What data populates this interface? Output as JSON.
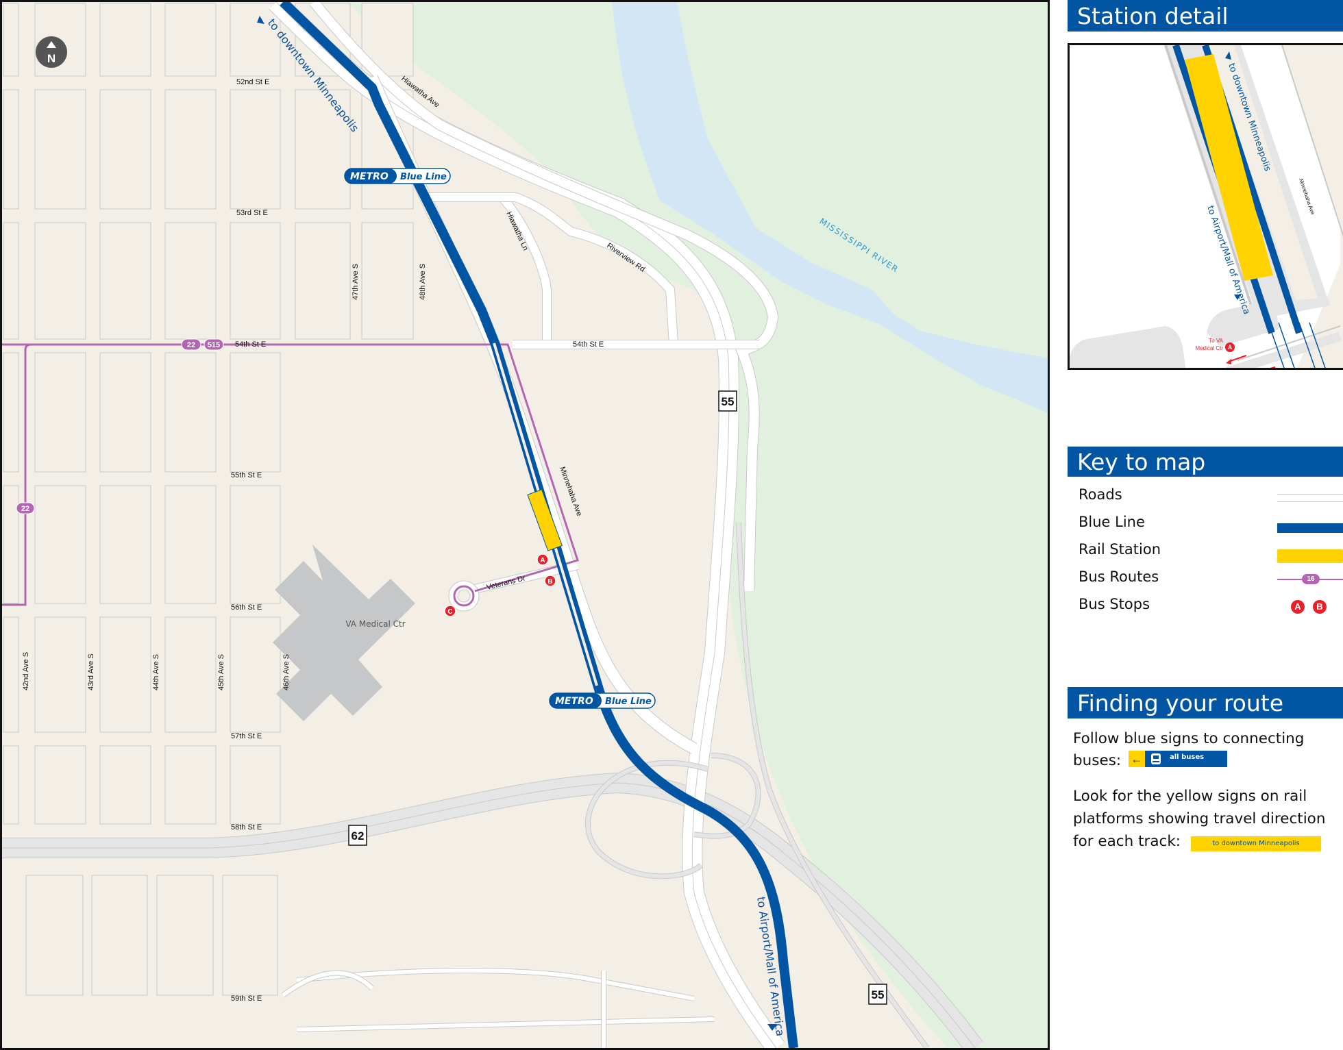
{
  "map": {
    "north_label": "N",
    "streets_ew": [
      "52nd St E",
      "53rd St E",
      "54th St E",
      "54th St E",
      "55th St E",
      "56th St E",
      "57th St E",
      "58th St E",
      "59th St E"
    ],
    "streets_ns": [
      "42nd Ave S",
      "43rd Ave S",
      "44th Ave S",
      "45th Ave S",
      "46th Ave S",
      "47th Ave S",
      "48th Ave S"
    ],
    "other_roads": {
      "hiawatha_ave": "Hiawatha Ave",
      "hiawatha_ln": "Hiawatha Ln",
      "riverview_rd": "Riverview Rd",
      "minnehaha_ave": "Minnehaha Ave",
      "veterans_dr": "Veterans Dr"
    },
    "river_label": "MISSISSIPPI RIVER",
    "landmark": "VA Medical Ctr",
    "direction_north": "to downtown Minneapolis",
    "direction_south": "to Airport/Mall of America",
    "metro_badge": {
      "brand": "METRO",
      "line": "Blue Line"
    },
    "highways": [
      "55",
      "62",
      "55"
    ],
    "bus_routes": [
      "22",
      "515",
      "22"
    ],
    "bus_stops": [
      "A",
      "B",
      "C"
    ]
  },
  "station_detail": {
    "title": "Station detail",
    "direction_north": "to downtown Minneapolis",
    "direction_south": "to Airport/Mall of America",
    "street": "Minnehaha Ave",
    "bus_stop_note_line1": "To VA",
    "bus_stop_note_line2": "Medical Ctr",
    "bus_stop": "A"
  },
  "key": {
    "title": "Key to map",
    "items": [
      {
        "label": "Roads",
        "symbol": "road"
      },
      {
        "label": "Blue Line",
        "symbol": "blue-line",
        "color": "#0155a2"
      },
      {
        "label": "Rail Station",
        "symbol": "rail-station",
        "color": "#ffd200"
      },
      {
        "label": "Bus Routes",
        "symbol": "bus-route",
        "color": "#b266b2",
        "sample_route": "16"
      },
      {
        "label": "Bus Stops",
        "symbol": "bus-stop",
        "color": "#e8202a",
        "stops": [
          "A",
          "B"
        ]
      }
    ]
  },
  "finding_route": {
    "title": "Finding your route",
    "para1_line1": "Follow blue signs to connecting",
    "para1_line2": "buses:",
    "blue_sign_text": "all buses",
    "para2_line1": "Look for the yellow signs on rail",
    "para2_line2": "platforms showing travel direction",
    "para2_line3": "for each track:",
    "yellow_sign_text": "to downtown Minneapolis"
  },
  "colors": {
    "brand_blue": "#0155a2",
    "station_yellow": "#ffd200",
    "bus_purple": "#b266b2",
    "stop_red": "#e8202a",
    "land": "#f3efe7",
    "park": "#e2f0df",
    "water": "#d3e6f5"
  }
}
